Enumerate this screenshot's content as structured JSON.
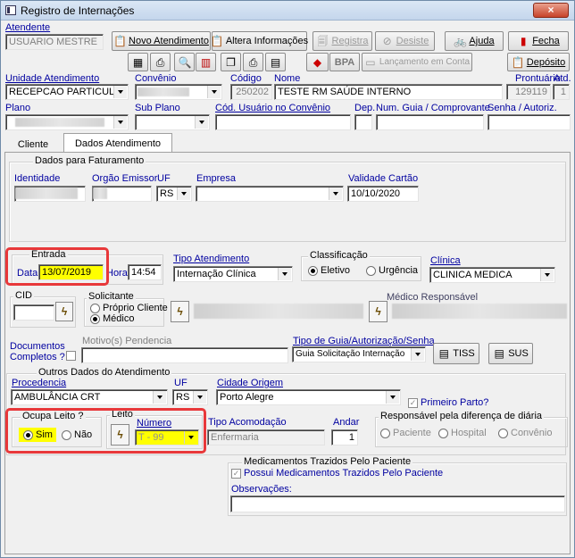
{
  "window": {
    "title": "Registro de Internações",
    "close_glyph": "×"
  },
  "toolbar": {
    "atendente_label": "Atendente",
    "atendente_value": "USUARIO MESTRE",
    "novo_atendimento": "Novo Atendimento",
    "altera_informacoes": "Altera Informações",
    "registra": "Registra",
    "desiste": "Desiste",
    "ajuda": "Ajuda",
    "fecha": "Fecha",
    "bpa": "BPA",
    "lancamento_conta": "Lançamento em Conta",
    "deposito": "Depósito"
  },
  "header": {
    "unidade_label": "Unidade Atendimento",
    "unidade_value": "RECEPCAO PARTICULA",
    "convenio_label": "Convênio",
    "codigo_label": "Código",
    "codigo_value": "250202",
    "nome_label": "Nome",
    "nome_value": "TESTE RM SAÚDE INTERNO",
    "prontuario_label": "Prontuário",
    "prontuario_value": "129119",
    "atd_label": "Atd.",
    "atd_value": "1",
    "plano_label": "Plano",
    "subplano_label": "Sub Plano",
    "cod_usuario_label": "Cód. Usuário no Convênio",
    "dep_label": "Dep.",
    "num_guia_label": "Num. Guia / Comprovante",
    "senha_label": "Senha / Autoriz."
  },
  "tabs": [
    "Cliente",
    "Dados Atendimento"
  ],
  "faturamento": {
    "title": "Dados para Faturamento",
    "identidade_label": "Identidade",
    "orgao_label": "Orgão Emissor",
    "uf_label": "UF",
    "uf_value": "RS",
    "empresa_label": "Empresa",
    "validade_label": "Validade Cartão",
    "validade_value": "10/10/2020"
  },
  "entrada": {
    "title": "Entrada",
    "data_label": "Data",
    "data_value": "13/07/2019",
    "hora_label": "Hora",
    "hora_value": "14:54"
  },
  "tipo_atendimento": {
    "label": "Tipo Atendimento",
    "value": "Internação Clínica"
  },
  "classificacao": {
    "title": "Classificação",
    "opt1": "Eletivo",
    "opt2": "Urgência",
    "selected": "Eletivo"
  },
  "clinica": {
    "label": "Clínica",
    "value": "CLINICA MEDICA"
  },
  "cid": {
    "title": "CID"
  },
  "solicitante": {
    "title": "Solicitante",
    "opt1": "Próprio Cliente",
    "opt2": "Médico",
    "selected": "Médico"
  },
  "medico": {
    "label": "Médico Responsável"
  },
  "documentos": {
    "label1": "Documentos",
    "label2": "Completos ?",
    "motivo_label": "Motivo(s) Pendencia"
  },
  "guia": {
    "label": "Tipo de Guia/Autorização/Senha",
    "value": "Guia Solicitação Internação",
    "tiss": "TISS",
    "sus": "SUS"
  },
  "outros": {
    "title": "Outros Dados do Atendimento",
    "procedencia_label": "Procedencia",
    "procedencia_value": "AMBULÂNCIA CRT",
    "uf_label": "UF",
    "uf_value": "RS",
    "cidade_label": "Cidade Origem",
    "cidade_value": "Porto Alegre",
    "primeiro_parto": "Primeiro Parto?"
  },
  "ocupa_leito": {
    "title": "Ocupa Leito ?",
    "sim": "Sim",
    "nao": "Não",
    "selected": "Sim"
  },
  "leito": {
    "title": "Leito",
    "numero_label": "Número",
    "numero_value": "T - 99"
  },
  "acomodacao": {
    "label": "Tipo Acomodação",
    "value": "Enfermaria",
    "andar_label": "Andar",
    "andar_value": "1"
  },
  "responsavel": {
    "title": "Responsável pela diferença de diária",
    "opt1": "Paciente",
    "opt2": "Hospital",
    "opt3": "Convênio"
  },
  "medicamentos": {
    "title": "Medicamentos Trazidos Pelo Paciente",
    "check_label": "Possui Medicamentos Trazidos Pelo Paciente",
    "obs_label": "Observações:"
  },
  "colors": {
    "highlight": "#ffff00",
    "annotation_border": "#e8383a",
    "label_blue": "#0000a0"
  }
}
